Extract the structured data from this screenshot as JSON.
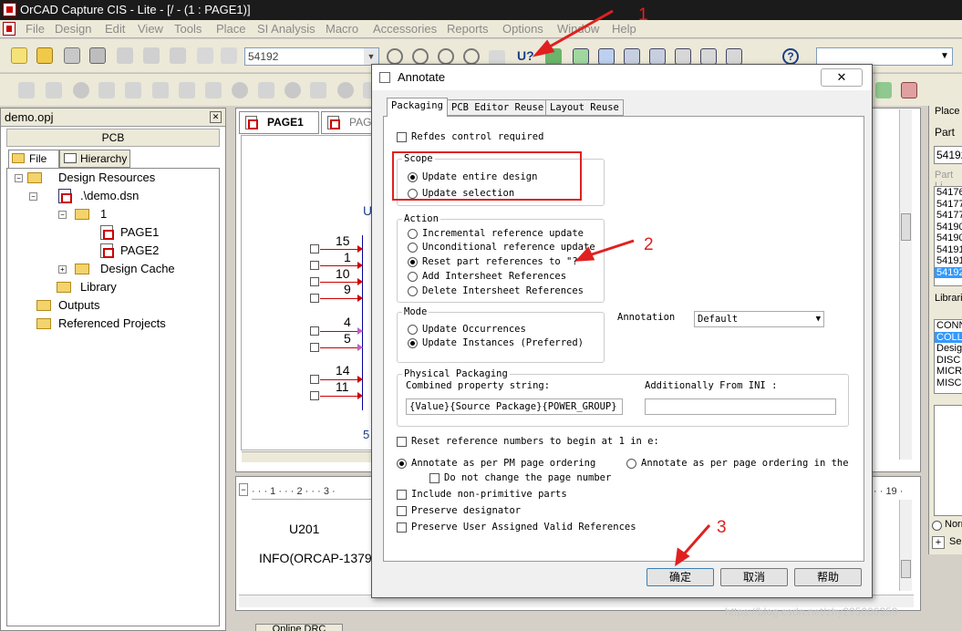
{
  "window": {
    "title": "OrCAD Capture CIS - Lite - [/ - (1 : PAGE1)]"
  },
  "menu": [
    "File",
    "Design",
    "Edit",
    "View",
    "Tools",
    "Place",
    "SI Analysis",
    "Macro",
    "Accessories",
    "Reports",
    "Options",
    "Window",
    "Help"
  ],
  "toolbar": {
    "part_combo_value": "54192"
  },
  "project": {
    "panel_title": "demo.opj",
    "header": "PCB",
    "tabs": [
      "File",
      "Hierarchy"
    ],
    "tree": [
      "Design Resources",
      ".\\demo.dsn",
      "1",
      "PAGE1",
      "PAGE2",
      "Design Cache",
      "Library",
      "Outputs",
      "Referenced Projects"
    ]
  },
  "schematic": {
    "tabs": [
      "PAGE1",
      "PAG"
    ],
    "part_ref_partial": "U",
    "pin_numbers": [
      "15",
      "1",
      "10",
      "9",
      "4",
      "5",
      "14",
      "11"
    ],
    "bottom_partial": "5"
  },
  "log": {
    "ruler_left": "· · · 1 · · · 2 · · · 3 ·",
    "ruler_right": "· · 19 ·",
    "line1": "U201",
    "line2": "INFO(ORCAP-1379",
    "bottom_tab": "Online DRC"
  },
  "place_panel": {
    "title": "Place",
    "part_label": "Part",
    "part_value": "54192",
    "part_list_label": "Part Li",
    "part_list": [
      "54176",
      "54177",
      "54177",
      "54190",
      "54190",
      "54191",
      "54191",
      "54192"
    ],
    "libraries_label": "Librari",
    "libraries": [
      "CONN",
      "COLL",
      "Desig",
      "DISC",
      "MICR",
      "MISC"
    ],
    "normal_label": "Norm",
    "search_label": "Se"
  },
  "dialog": {
    "title": "Annotate",
    "close_label": "✕",
    "tabs": [
      "Packaging",
      "PCB Editor Reuse",
      "Layout Reuse"
    ],
    "refdes_control": "Refdes control required",
    "scope": {
      "title": "Scope",
      "options": [
        "Update entire design",
        "Update selection"
      ],
      "selected": 0
    },
    "action": {
      "title": "Action",
      "options": [
        "Incremental reference update",
        "Unconditional reference update",
        "Reset part references to \"?\"",
        "Add Intersheet References",
        "Delete Intersheet References"
      ],
      "selected": 2
    },
    "mode": {
      "title": "Mode",
      "options": [
        "Update Occurrences",
        "Update Instances (Preferred)"
      ],
      "selected": 1
    },
    "annotation_label": "Annotation",
    "annotation_value": "Default",
    "physical_packaging": {
      "title": "Physical Packaging",
      "combined_label": "Combined property string:",
      "combined_value": "{Value}{Source Package}{POWER_GROUP}",
      "ini_label": "Additionally From INI :",
      "ini_value": ""
    },
    "reset_numbers": "Reset reference numbers to begin at 1 in e:",
    "ordering_pm": "Annotate as per PM page ordering",
    "ordering_page": "Annotate as per page ordering in the ti",
    "no_change_page": "Do not change the page number",
    "include_nonprimitive": "Include non-primitive parts",
    "preserve_designator": "Preserve designator",
    "preserve_user": "Preserve User Assigned Valid References",
    "buttons": {
      "ok": "确定",
      "cancel": "取消",
      "help": "帮助"
    }
  },
  "annotations": [
    "1",
    "2",
    "3"
  ],
  "watermark": "https://blog.csdn.net/zhy295006359",
  "colors": {
    "annotation_red": "#e02020",
    "selection_blue": "#3399ff"
  }
}
